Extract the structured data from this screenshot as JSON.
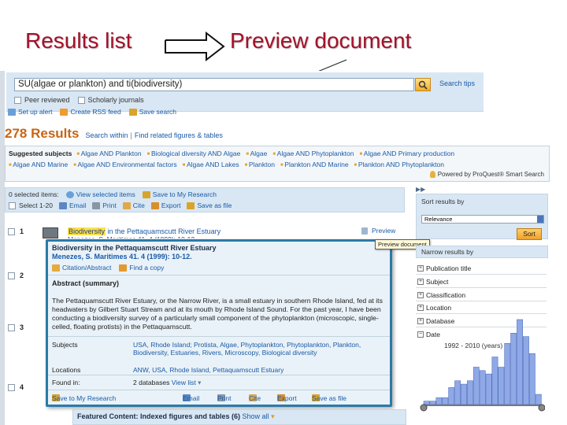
{
  "slide": {
    "left_title": "Results list",
    "right_title": "Preview document"
  },
  "search": {
    "query": "SU(algae or plankton) and ti(biodiversity)",
    "tips": "Search tips",
    "peer_reviewed": "Peer reviewed",
    "scholarly": "Scholarly journals",
    "set_alert": "Set up alert",
    "rss": "Create RSS feed",
    "save_search": "Save search"
  },
  "results": {
    "count": "278 Results",
    "search_within": "Search within",
    "related": "Find related figures & tables"
  },
  "suggested": {
    "label": "Suggested subjects",
    "row1": [
      "Algae AND Plankton",
      "Biological diversity AND Algae",
      "Algae",
      "Algae AND Phytoplankton",
      "Algae AND Primary production"
    ],
    "row2": [
      "Algae AND Marine",
      "Algae AND Environmental factors",
      "Algae AND Lakes",
      "Plankton",
      "Plankton AND Marine",
      "Plankton AND Phytoplankton"
    ],
    "powered": "Powered by ProQuest® Smart Search"
  },
  "toolbar": {
    "selected": "0 selected items:",
    "view_selected": "View selected items",
    "save_research": "Save to My Research",
    "select_range": "Select 1-20",
    "email": "Email",
    "print": "Print",
    "cite": "Cite",
    "export": "Export",
    "save_file": "Save as file"
  },
  "list": {
    "rows": [
      "1",
      "2",
      "3",
      "4"
    ],
    "first_title_hl": "Biodiversity",
    "first_title_rest": " in the Pettaquamscutt River Estuary",
    "preview": "Preview",
    "tooltip": "Preview document"
  },
  "popup": {
    "title": "Biodiversity in the Pettaquamscutt River Estuary",
    "author": "Menezes, S. Maritimes  41. 4   (1999): 10-12.",
    "citation_link": "Citation/Abstract",
    "find_copy": "Find a copy",
    "abstract_head": "Abstract (summary)",
    "abstract": "The Pettaquamscutt River Estuary, or the Narrow River, is a small estuary in southern Rhode Island, fed at its headwaters by Gilbert Stuart Stream and at its mouth by Rhode Island Sound. For the past year, I have been conducting a biodiversity survey of a particularly small component of the phytoplankton (microscopic, single-celled, floating protists) in the Pettaquamscutt.",
    "subjects_label": "Subjects",
    "subjects": "USA, Rhode Island; Protista, Algae, Phytoplankton, Phytoplankton, Plankton, Biodiversity, Estuaries, Rivers, Microscopy, Biological diversity",
    "locations_label": "Locations",
    "locations": "ANW, USA, Rhode Island, Pettaquamscutt Estuary",
    "found_label": "Found in:",
    "found": "2 databases",
    "view_list": "View list",
    "save_research": "Save to My Research",
    "email": "Email",
    "print": "Print",
    "cite": "Cite",
    "export": "Export",
    "save_file": "Save as file"
  },
  "featured": {
    "label": "Featured Content: Indexed figures and tables (6)",
    "show_all": "Show all"
  },
  "sidebar": {
    "sort_label": "Sort results by",
    "sort_value": "Relevance",
    "sort_button": "Sort",
    "narrow": "Narrow results by",
    "facets": [
      "Publication title",
      "Subject",
      "Classification",
      "Location",
      "Database",
      "Date"
    ],
    "year_range": "1992 - 2010 (years)"
  },
  "chart_data": {
    "type": "bar",
    "x": [
      1992,
      1993,
      1994,
      1995,
      1996,
      1997,
      1998,
      1999,
      2000,
      2001,
      2002,
      2003,
      2004,
      2005,
      2006,
      2007,
      2008,
      2009,
      2010
    ],
    "values": [
      1,
      1,
      2,
      2,
      5,
      7,
      6,
      7,
      11,
      10,
      9,
      14,
      11,
      18,
      21,
      25,
      20,
      15,
      3
    ],
    "colors": {
      "bar": "#8ea9e6",
      "stroke": "#4763b8"
    }
  }
}
